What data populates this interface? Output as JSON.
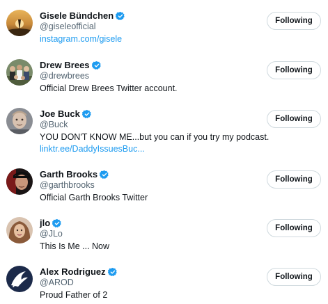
{
  "colors": {
    "text_primary": "#0f1419",
    "text_secondary": "#536471",
    "link": "#1d9bf0",
    "verified": "#1d9bf0",
    "button_border": "#cfd9de"
  },
  "accounts": [
    {
      "name": "Gisele Bündchen",
      "handle": "@giseleofficial",
      "bio": "",
      "link": "instagram.com/gisele",
      "verified": true,
      "button_label": "Following"
    },
    {
      "name": "Drew Brees",
      "handle": "@drewbrees",
      "bio": "Official Drew Brees Twitter account.",
      "link": "",
      "verified": true,
      "button_label": "Following"
    },
    {
      "name": "Joe Buck",
      "handle": "@Buck",
      "bio": "YOU DON'T KNOW ME...but you can if you try my podcast.",
      "link": "linktr.ee/DaddyIssuesBuc...",
      "verified": true,
      "button_label": "Following"
    },
    {
      "name": "Garth Brooks",
      "handle": "@garthbrooks",
      "bio": "Official Garth Brooks Twitter",
      "link": "",
      "verified": true,
      "button_label": "Following"
    },
    {
      "name": "jlo",
      "handle": "@JLo",
      "bio": "This Is Me ... Now",
      "link": "",
      "verified": true,
      "button_label": "Following"
    },
    {
      "name": "Alex Rodriguez",
      "handle": "@AROD",
      "bio": "Proud Father of 2",
      "link": "",
      "verified": true,
      "button_label": "Following"
    }
  ]
}
